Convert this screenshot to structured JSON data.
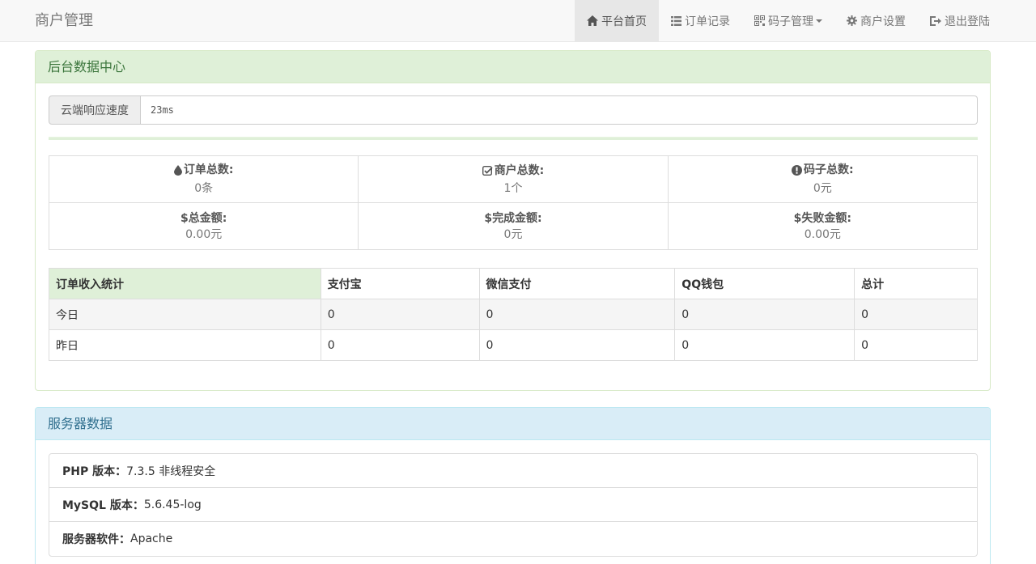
{
  "navbar": {
    "brand": "商户管理",
    "items": [
      {
        "label": "平台首页",
        "icon": "home-icon",
        "active": true
      },
      {
        "label": "订单记录",
        "icon": "list-icon",
        "active": false
      },
      {
        "label": "码子管理",
        "icon": "qrcode-icon",
        "active": false
      },
      {
        "label": "商户设置",
        "icon": "gear-icon",
        "active": false
      },
      {
        "label": "退出登陆",
        "icon": "logout-icon",
        "active": false
      }
    ]
  },
  "data_panel": {
    "title": "后台数据中心",
    "cloud_speed": {
      "label": "云端响应速度",
      "value": "23ms"
    },
    "stats": [
      {
        "label": "订单总数:",
        "value": "0条",
        "icon": "tint-icon"
      },
      {
        "label": "商户总数:",
        "value": "1个",
        "icon": "check-square-icon"
      },
      {
        "label": "码子总数:",
        "value": "0元",
        "icon": "exclamation-circle-icon"
      },
      {
        "label": "总金额:",
        "value": "0.00元",
        "icon": "dollar-icon"
      },
      {
        "label": "完成金额:",
        "value": "0元",
        "icon": "dollar-icon"
      },
      {
        "label": "失败金额:",
        "value": "0.00元",
        "icon": "dollar-icon"
      }
    ],
    "income_table": {
      "headers": [
        "订单收入统计",
        "支付宝",
        "微信支付",
        "QQ钱包",
        "总计"
      ],
      "rows": [
        [
          "今日",
          "0",
          "0",
          "0",
          "0"
        ],
        [
          "昨日",
          "0",
          "0",
          "0",
          "0"
        ]
      ]
    }
  },
  "server_panel": {
    "title": "服务器数据",
    "items": [
      {
        "label": "PHP 版本：",
        "value": "7.3.5 非线程安全"
      },
      {
        "label": "MySQL 版本：",
        "value": "5.6.45-log"
      },
      {
        "label": "服务器软件：",
        "value": "Apache"
      }
    ]
  },
  "colors": {
    "success_heading": "#dff0d8",
    "info_heading": "#d9edf7",
    "navbar_bg": "#f8f8f8",
    "active_nav_bg": "#e7e7e7"
  }
}
